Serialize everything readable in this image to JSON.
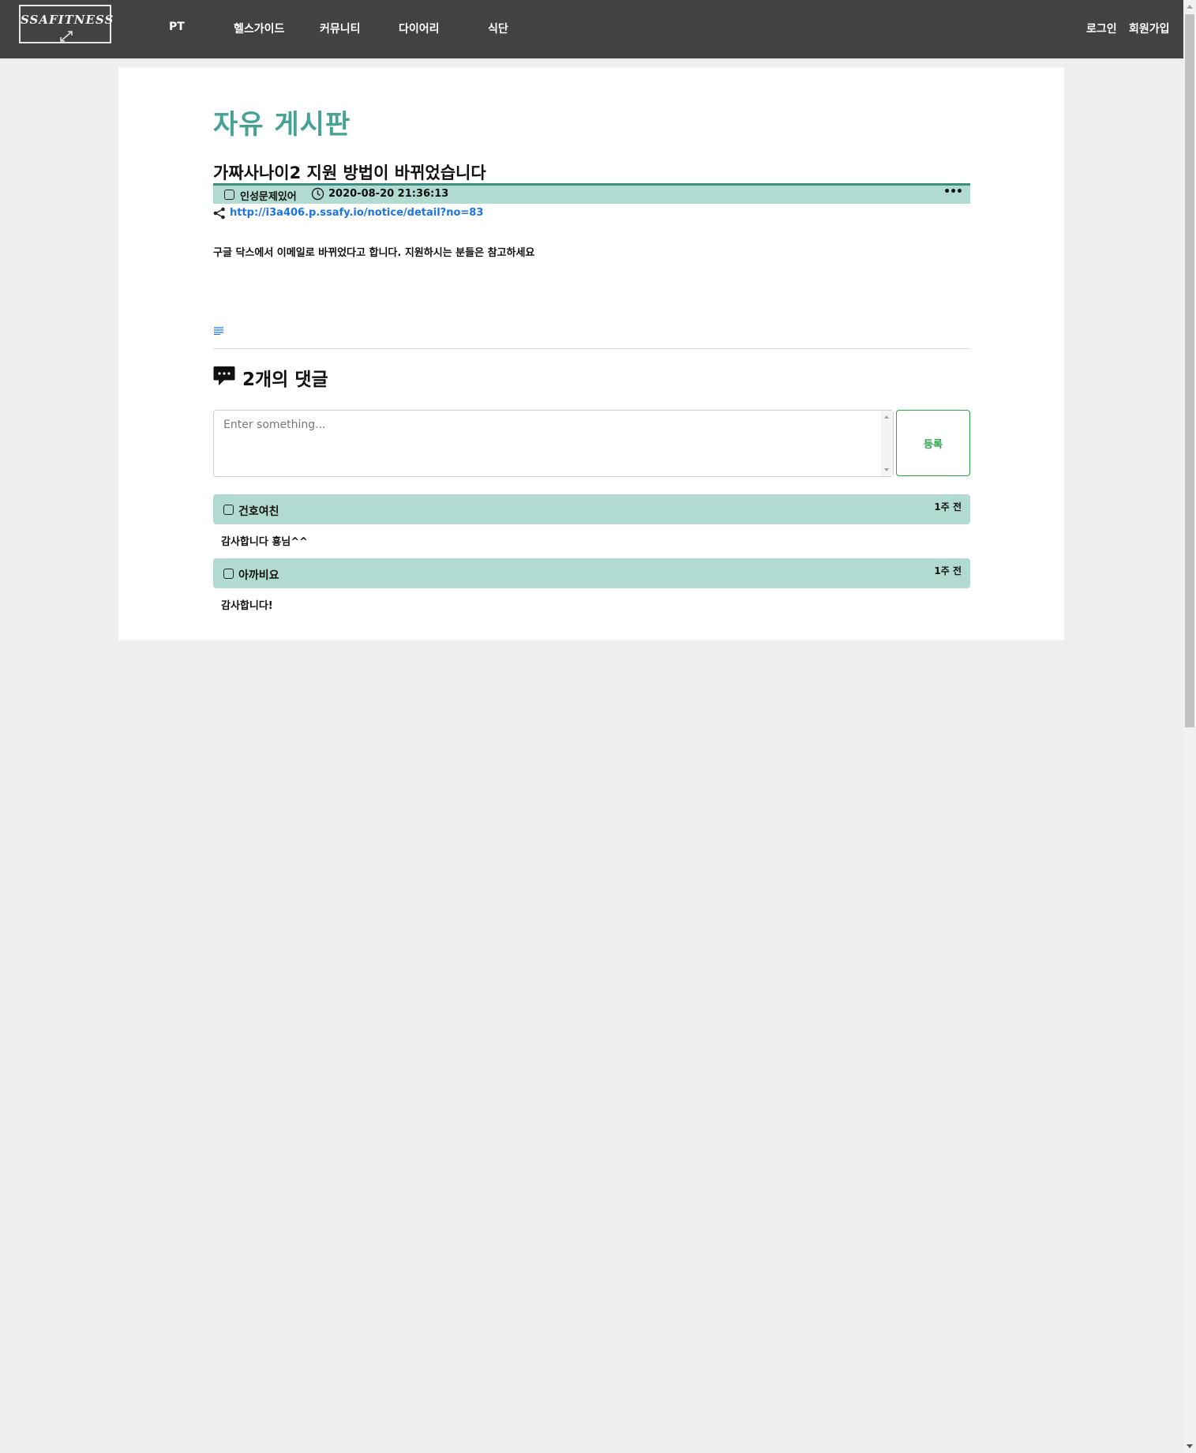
{
  "nav": {
    "logo_text": "SSAFITNESS",
    "items": [
      "PT",
      "헬스가이드",
      "커뮤니티",
      "다이어리",
      "식단"
    ],
    "login": "로그인",
    "signup": "회원가입"
  },
  "board": {
    "title": "자유 게시판"
  },
  "post": {
    "title": "가짜사나이2 지원 방법이 바뀌었습니다",
    "author": "인성문제있어",
    "date": "2020-08-20 21:36:13",
    "more": "•••",
    "link": "http://i3a406.p.ssafy.io/notice/detail?no=83",
    "body": "구글 닥스에서 이메일로 바뀌었다고 합니다. 지원하시는 분들은 참고하세요"
  },
  "comments": {
    "count_label": "2개의 댓글",
    "input_placeholder": "Enter something...",
    "submit_label": "등록",
    "items": [
      {
        "author": "건호여친",
        "time": "1주 전",
        "text": "감사합니다 횽님^^"
      },
      {
        "author": "아까비요",
        "time": "1주 전",
        "text": "감사합니다!"
      }
    ]
  },
  "colors": {
    "navbar": "#424242",
    "accent": "#46a292",
    "meta_bg": "#b1dbd1",
    "link": "#1e73e8",
    "submit": "#2ea34a",
    "page_bg": "#eeeeee"
  }
}
